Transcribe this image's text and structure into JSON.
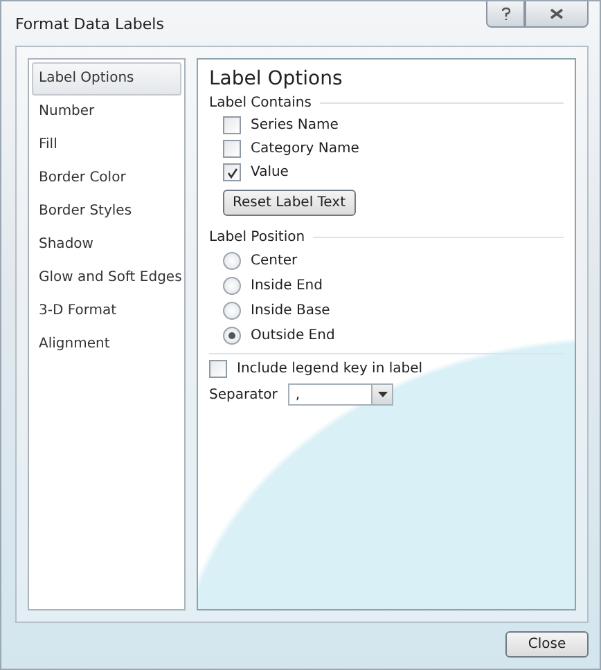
{
  "window": {
    "title": "Format Data Labels"
  },
  "sidebar": {
    "items": [
      {
        "label": "Label Options",
        "selected": true
      },
      {
        "label": "Number",
        "selected": false
      },
      {
        "label": "Fill",
        "selected": false
      },
      {
        "label": "Border Color",
        "selected": false
      },
      {
        "label": "Border Styles",
        "selected": false
      },
      {
        "label": "Shadow",
        "selected": false
      },
      {
        "label": "Glow and Soft Edges",
        "selected": false
      },
      {
        "label": "3-D Format",
        "selected": false
      },
      {
        "label": "Alignment",
        "selected": false
      }
    ]
  },
  "panel": {
    "title": "Label Options",
    "label_contains": {
      "heading": "Label Contains",
      "options": [
        {
          "label": "Series Name",
          "checked": false
        },
        {
          "label": "Category Name",
          "checked": false
        },
        {
          "label": "Value",
          "checked": true
        }
      ],
      "reset_button": "Reset Label Text"
    },
    "label_position": {
      "heading": "Label Position",
      "options": [
        {
          "label": "Center",
          "selected": false
        },
        {
          "label": "Inside End",
          "selected": false
        },
        {
          "label": "Inside Base",
          "selected": false
        },
        {
          "label": "Outside End",
          "selected": true
        }
      ]
    },
    "legend_key": {
      "label": "Include legend key in label",
      "checked": false
    },
    "separator": {
      "label": "Separator",
      "value": ","
    }
  },
  "buttons": [
    "Close"
  ]
}
